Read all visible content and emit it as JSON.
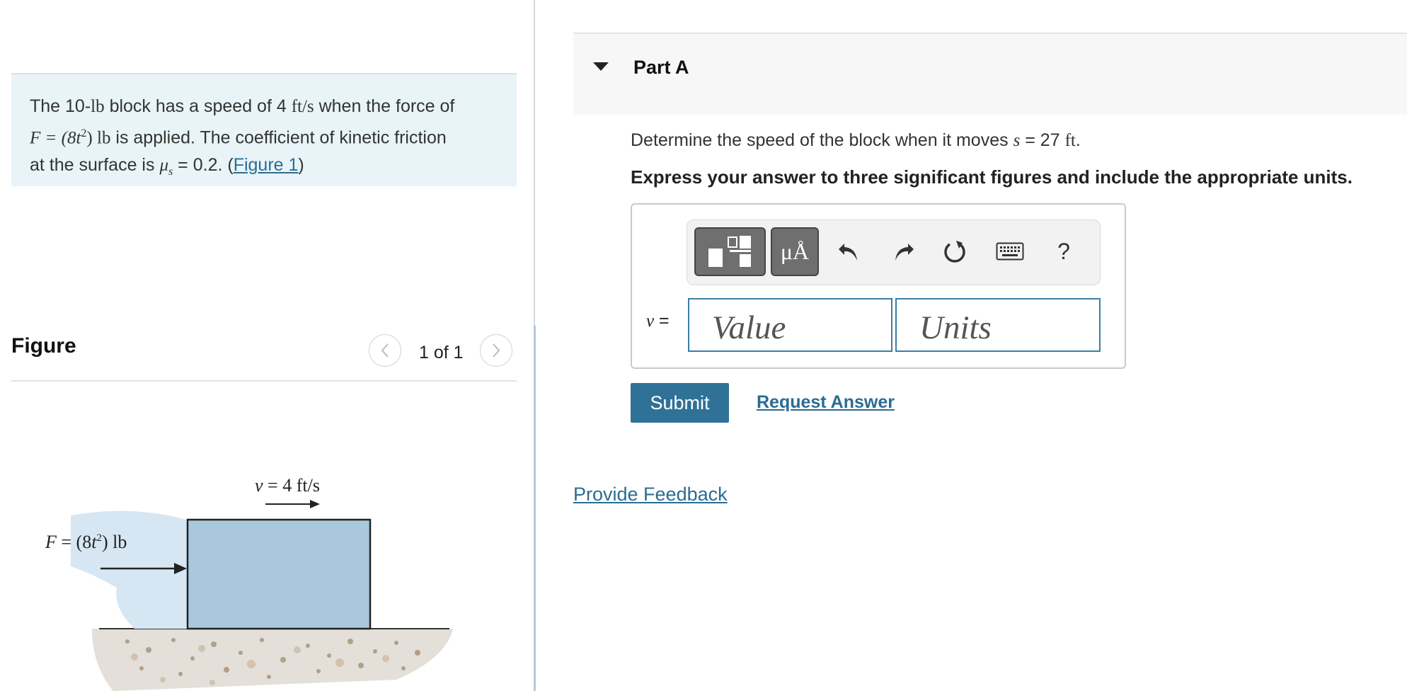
{
  "problem": {
    "text_1": "The 10-",
    "unit_lb": "lb",
    "text_2": " block has a speed of 4 ",
    "unit_speed": "ft/s",
    "text_3": " when the force of",
    "force_eq": "F = (8t",
    "force_exp": "2",
    "force_close": ") lb",
    "text_4": " is applied. The coefficient of kinetic friction",
    "text_5": "at the surface is ",
    "mu": "μ",
    "mu_sub": "s",
    "text_6": " = 0.2. (",
    "figure_link": "Figure 1",
    "text_7": ")"
  },
  "figure": {
    "heading": "Figure",
    "pager": "1 of 1",
    "velocity_label": "v = 4 ft/s",
    "force_label": "F = (8t",
    "force_label_exp": "2",
    "force_label_end": ") lb"
  },
  "part": {
    "title": "Part A",
    "question_1": "Determine the speed of the block when it moves ",
    "question_var": "s",
    "question_2": " = 27 ",
    "question_unit": "ft",
    "question_3": ".",
    "instruction": "Express your answer to three significant figures and include the appropriate units."
  },
  "answer": {
    "var_label": "v",
    "eq": " =",
    "value_placeholder": "Value",
    "units_placeholder": "Units",
    "symbols_label": "μÅ",
    "help_label": "?"
  },
  "actions": {
    "submit": "Submit",
    "request_answer": "Request Answer",
    "provide_feedback": "Provide Feedback"
  },
  "colors": {
    "problem_bg": "#e8f4f7",
    "block_fill": "#a9c8de",
    "accent": "#2f7197",
    "link": "#2a6d93"
  }
}
